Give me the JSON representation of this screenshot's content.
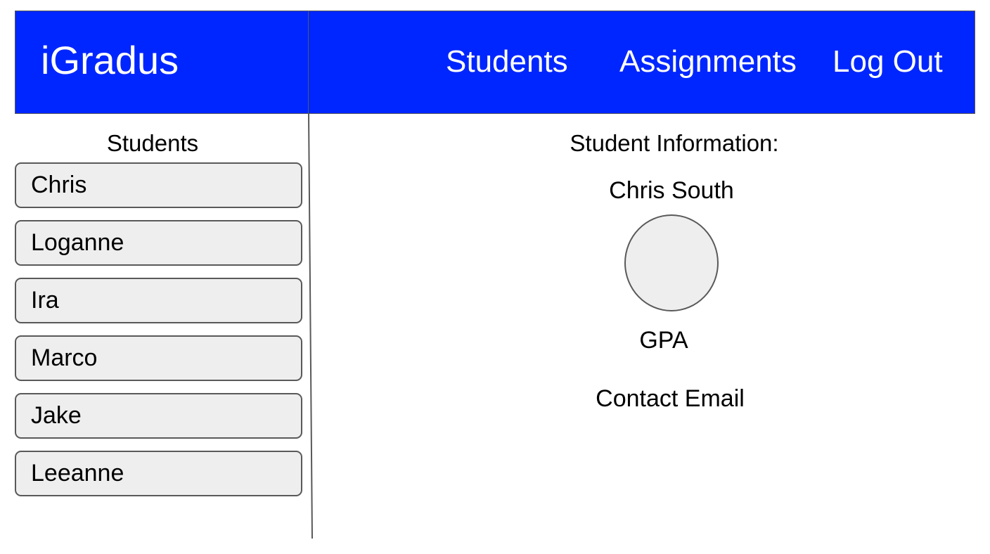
{
  "header": {
    "brand": "iGradus",
    "nav": {
      "students": "Students",
      "assignments": "Assignments",
      "log_out": "Log Out"
    },
    "background_color": "#0026ff"
  },
  "sidebar": {
    "title": "Students",
    "students": [
      "Chris",
      "Loganne",
      "Ira",
      "Marco",
      "Jake",
      "Leeanne"
    ]
  },
  "student_info": {
    "title": "Student Information:",
    "name": "Chris South",
    "gpa_label": "GPA",
    "email_label": "Contact Email"
  }
}
